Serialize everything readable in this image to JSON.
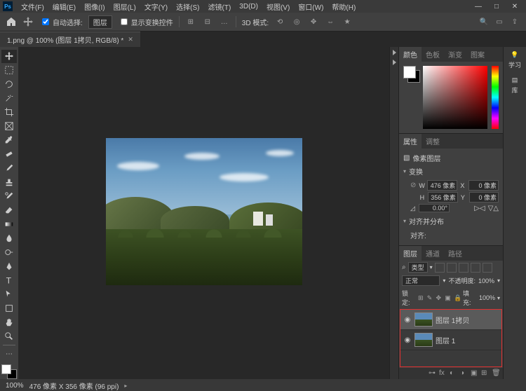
{
  "app_logo": "Ps",
  "menu": [
    "文件(F)",
    "编辑(E)",
    "图像(I)",
    "图层(L)",
    "文字(Y)",
    "选择(S)",
    "滤镜(T)",
    "3D(D)",
    "视图(V)",
    "窗口(W)",
    "帮助(H)"
  ],
  "optbar": {
    "auto_select_label": "自动选择:",
    "auto_select_mode": "图层",
    "show_transform": "显示变换控件",
    "mode_3d_label": "3D 模式:"
  },
  "tab": {
    "title": "1.png @ 100% (图层 1拷贝, RGB/8) *"
  },
  "rightbar": {
    "learn": "学习",
    "lib": "库"
  },
  "color_panel": {
    "tabs": [
      "颜色",
      "色板",
      "渐变",
      "图案"
    ]
  },
  "props_panel": {
    "tabs": [
      "属性",
      "调整"
    ],
    "pixel_layer": "像素图层",
    "transform": "变换",
    "w": "476 像素",
    "x": "0 像素",
    "h": "356 像素",
    "y": "0 像素",
    "angle": "0.00°",
    "align_title": "对齐并分布",
    "align": "对齐:"
  },
  "layers_panel": {
    "tabs": [
      "图层",
      "通道",
      "路径"
    ],
    "kind": "类型",
    "blend": "正常",
    "opacity_label": "不透明度:",
    "opacity": "100%",
    "lock_label": "锁定:",
    "fill_label": "填充:",
    "fill": "100%",
    "layers": [
      {
        "name": "图层 1拷贝",
        "selected": true
      },
      {
        "name": "图层 1",
        "selected": false
      }
    ]
  },
  "status": {
    "zoom": "100%",
    "dims": "476 像素 X 356 像素 (96 ppi)"
  }
}
